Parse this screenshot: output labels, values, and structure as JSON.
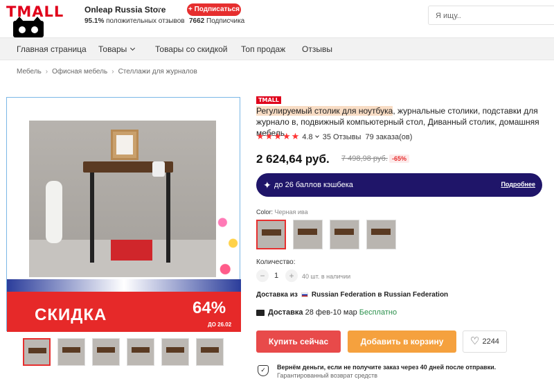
{
  "header": {
    "logo_text": "TMALL",
    "store_name": "Onleap Russia Store",
    "rating_value": "95.1%",
    "rating_label": "положительных отзывов",
    "subscribe_label": "+ Подписаться",
    "subscribers_count": "7662",
    "subscribers_label": "Подписчика",
    "search_placeholder": "Я ищу.."
  },
  "nav": {
    "items": [
      "Главная страница",
      "Товары",
      "Товары со скидкой",
      "Топ продаж",
      "Отзывы"
    ]
  },
  "breadcrumb": [
    "Мебель",
    "Офисная мебель",
    "Стеллажи для журналов"
  ],
  "gallery": {
    "banner_text": "СКИДКА",
    "banner_percent": "64%",
    "banner_date": "ДО 26.02"
  },
  "product": {
    "badge": "TMALL",
    "title_highlight": "Регулируемый столик для ноутбука",
    "title_rest": ", журнальные столики, подставки для журнало в, подвижный компьютерный стол, Диванный столик, домашняя мебель",
    "rating": "4.8",
    "reviews": "35 Отзывы",
    "orders": "79 заказа(ов)",
    "price": "2 624,64 руб.",
    "old_price": "7 498,98 руб.",
    "discount": "-65%",
    "cashback_text": "до 26 баллов кэшбека",
    "cashback_link": "Подробнее",
    "color_label": "Color:",
    "color_value": "Черная ива",
    "qty_label": "Количество:",
    "qty_value": "1",
    "qty_stock": "40 шт. в наличии",
    "ship_from_label": "Доставка из",
    "ship_from_value": "Russian Federation в Russian Federation",
    "delivery_label": "Доставка",
    "delivery_dates": "28 фев-10 мар",
    "delivery_free": "Бесплатно",
    "buy_label": "Купить сейчас",
    "cart_label": "Добавить в корзину",
    "wishlist_count": "2244",
    "guarantee_title": "Вернём деньги, если не получите заказ через 40 дней после отправки.",
    "guarantee_sub": "Гарантированный возврат средств"
  },
  "colors": {
    "accent": "#e62e2e",
    "cashback_bg": "#1f1569",
    "cart": "#f5a13e",
    "buy": "#e84a4a"
  }
}
